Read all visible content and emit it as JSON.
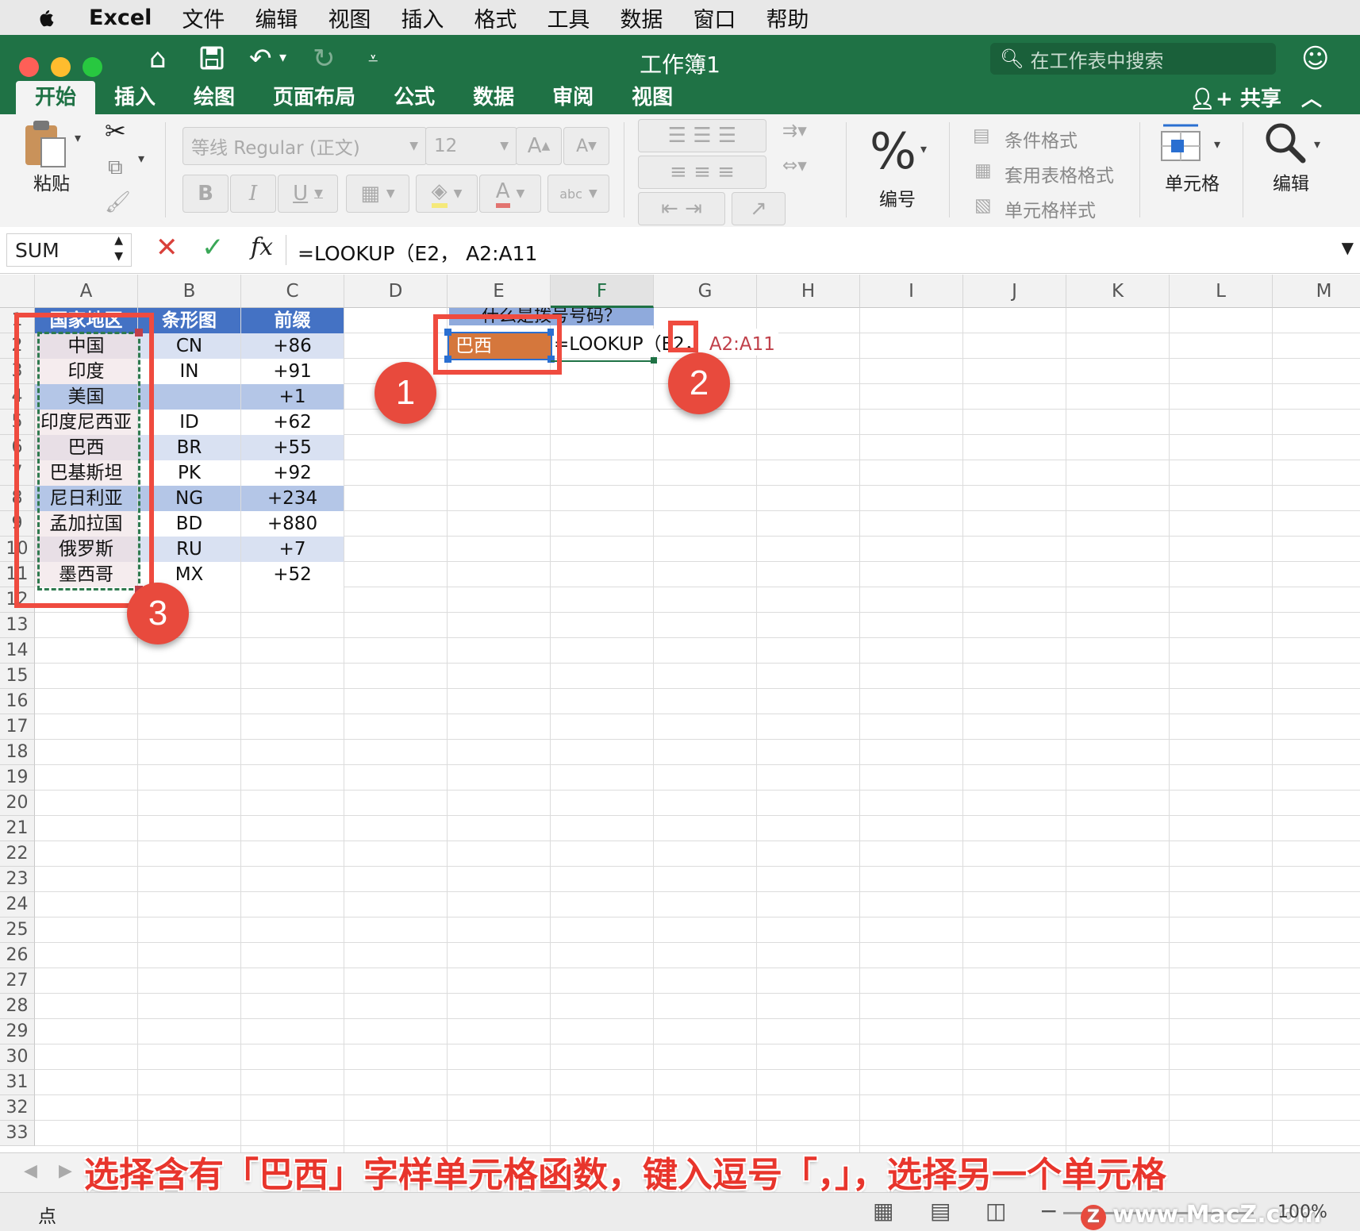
{
  "menubar": {
    "app": "Excel",
    "items": [
      "文件",
      "编辑",
      "视图",
      "插入",
      "格式",
      "工具",
      "数据",
      "窗口",
      "帮助"
    ]
  },
  "window": {
    "title": "工作簿1",
    "search_placeholder": "在工作表中搜索"
  },
  "tabs": [
    "开始",
    "插入",
    "绘图",
    "页面布局",
    "公式",
    "数据",
    "审阅",
    "视图"
  ],
  "share_label": "共享",
  "ribbon": {
    "paste_label": "粘贴",
    "font_name": "等线 Regular (正文)",
    "font_size": "12",
    "bold": "B",
    "italic": "I",
    "underline": "U",
    "number_label": "编号",
    "number_symbol": "%",
    "conditional_format": "条件格式",
    "table_format": "套用表格格式",
    "cell_styles": "单元格样式",
    "cells_label": "单元格",
    "edit_label": "编辑"
  },
  "formulabar": {
    "namebox": "SUM",
    "fx": "fx",
    "formula": "=LOOKUP（E2，  A2:A11"
  },
  "columns": [
    "A",
    "B",
    "C",
    "D",
    "E",
    "F",
    "G",
    "H",
    "I",
    "J",
    "K",
    "L",
    "M"
  ],
  "rows": [
    "1",
    "2",
    "3",
    "4",
    "5",
    "6",
    "7",
    "8",
    "9",
    "10",
    "11",
    "12",
    "13",
    "14",
    "15",
    "16",
    "17",
    "18",
    "19",
    "20",
    "21",
    "22",
    "23",
    "24",
    "25",
    "26",
    "27",
    "28",
    "29",
    "30",
    "31",
    "32",
    "33"
  ],
  "table": {
    "headers": [
      "国家地区",
      "条形图",
      "前缀"
    ],
    "rows": [
      [
        "中国",
        "CN",
        "+86"
      ],
      [
        "印度",
        "IN",
        "+91"
      ],
      [
        "美国",
        "",
        "+1"
      ],
      [
        "印度尼西亚",
        "ID",
        "+62"
      ],
      [
        "巴西",
        "BR",
        "+55"
      ],
      [
        "巴基斯坦",
        "PK",
        "+92"
      ],
      [
        "尼日利亚",
        "NG",
        "+234"
      ],
      [
        "孟加拉国",
        "BD",
        "+880"
      ],
      [
        "俄罗斯",
        "RU",
        "+7"
      ],
      [
        "墨西哥",
        "MX",
        "+52"
      ]
    ]
  },
  "lookup": {
    "question": "什么是拨号号码？",
    "selected_value": "巴西",
    "formula_in_cell": "=LOOKUP（E2，",
    "range_ref": "A2:A11"
  },
  "badges": [
    "1",
    "2",
    "3"
  ],
  "caption": "选择含有「巴西」字样单元格函数，键入逗号「，」，选择另一个单元格",
  "statusbar": {
    "mode": "点",
    "zoom": "100%",
    "watermark": "www.MacZ.com"
  },
  "colors": {
    "excel_green": "#1f7245",
    "header_blue": "#4472c4",
    "band_dark": "#b4c6e7",
    "band_light": "#d9e1f2",
    "orange": "#d5773c",
    "annotation_red": "#ef4b3f"
  }
}
